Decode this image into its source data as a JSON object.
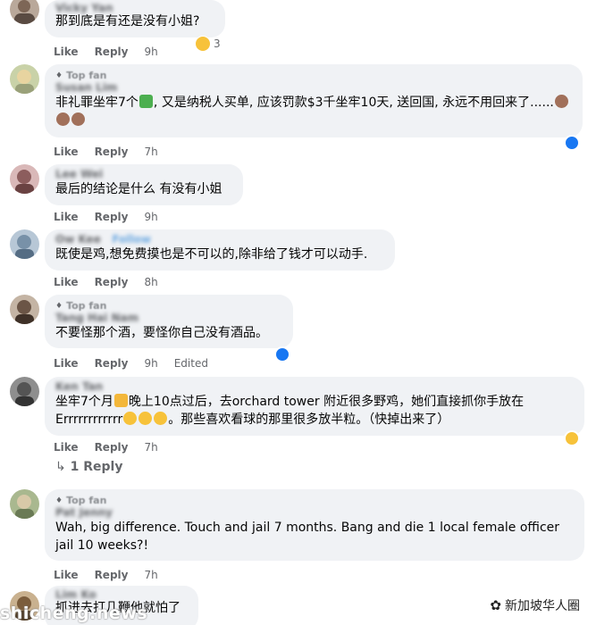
{
  "comments": [
    {
      "author": "Vicky Yan",
      "badge": "",
      "text": "那到底是有还是没有小姐?",
      "like": "Like",
      "reply": "Reply",
      "time": "9h",
      "reaction_count": "3"
    },
    {
      "author": "Susan Lim",
      "badge": "Top fan",
      "text_pre": "非礼罪坐牢7个",
      "text_post": ", 又是纳税人买单, 应该罚款$3千坐牢10天, 送回国, 永远不用回来了......",
      "like": "Like",
      "reply": "Reply",
      "time": "7h"
    },
    {
      "author": "Lee Wei",
      "badge": "",
      "text": "最后的结论是什么 有没有小姐",
      "like": "Like",
      "reply": "Reply",
      "time": "9h"
    },
    {
      "author": "Ow Kee",
      "author_tag": "Follow",
      "badge": "",
      "text": "既使是鸡,想免费摸也是不可以的,除非给了钱才可以动手.",
      "like": "Like",
      "reply": "Reply",
      "time": "8h"
    },
    {
      "author": "Tang Hai Nam",
      "badge": "Top fan",
      "text": "不要怪那个酒，要怪你自己没有酒品。",
      "like": "Like",
      "reply": "Reply",
      "time": "9h",
      "edited": "Edited"
    },
    {
      "author": "Ken Tan",
      "badge": "",
      "text_a": "坐牢7个月",
      "text_b": "晚上10点过后，去orchard tower 附近很多野鸡，她们直接抓你手放在",
      "text_c": "Errrrrrrrrrrr",
      "text_d": "。那些喜欢看球的那里很多放半粒。（快掉出来了）",
      "like": "Like",
      "reply": "Reply",
      "time": "7h",
      "replies": "1 Reply"
    },
    {
      "author": "Pat Jenny",
      "badge": "Top fan",
      "text": "Wah, big difference. Touch and jail 7 months. Bang and die 1 local female officer jail 10 weeks?!",
      "like": "Like",
      "reply": "Reply",
      "time": "7h"
    },
    {
      "author": "Lim Ko",
      "badge": "",
      "text": "抓进去打几鞭他就怕了"
    }
  ],
  "watermark": {
    "label": "新加坡华人圈",
    "site": "shicheng.news"
  }
}
